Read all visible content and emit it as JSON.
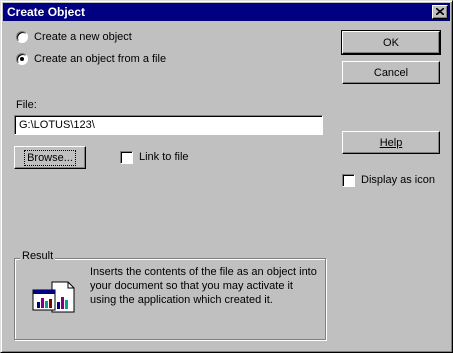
{
  "window": {
    "title": "Create Object"
  },
  "options": {
    "new_object": {
      "label": "Create a new object",
      "selected": false
    },
    "from_file": {
      "label": "Create an object from a file",
      "selected": true
    }
  },
  "buttons": {
    "ok": "OK",
    "cancel": "Cancel",
    "help": "Help",
    "browse": "Browse..."
  },
  "file": {
    "label": "File:",
    "value": "G:\\LOTUS\\123\\"
  },
  "link_to_file": {
    "label": "Link to file",
    "checked": false
  },
  "display_as_icon": {
    "label": "Display as icon",
    "checked": false
  },
  "result": {
    "title": "Result",
    "text": "Inserts the contents of the file as an object into your document so that you may activate it using the application which created it."
  },
  "icons": {
    "close": "close-icon",
    "result": "document-chart-icon"
  },
  "colors": {
    "titlebar": "#000080",
    "face": "#c0c0c0"
  }
}
